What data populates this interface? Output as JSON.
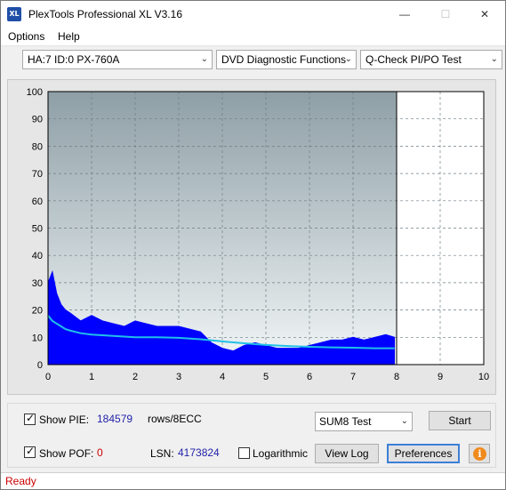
{
  "window": {
    "title": "PlexTools Professional XL V3.16",
    "icon_text": "XL",
    "minimize_glyph": "—",
    "maximize_glyph": "☐",
    "close_glyph": "✕"
  },
  "menu": {
    "options": "Options",
    "help": "Help"
  },
  "toolbar": {
    "drive": "HA:7 ID:0  PX-760A",
    "function": "DVD Diagnostic Functions",
    "test": "Q-Check PI/PO Test",
    "arrow_glyph": "⌄"
  },
  "chart_data": {
    "type": "area",
    "x_ticks": [
      "0",
      "1",
      "2",
      "3",
      "4",
      "5",
      "6",
      "7",
      "8",
      "9",
      "10"
    ],
    "y_ticks": [
      "0",
      "10",
      "20",
      "30",
      "40",
      "50",
      "60",
      "70",
      "80",
      "90",
      "100"
    ],
    "xlim": [
      0,
      10
    ],
    "ylim": [
      0,
      100
    ],
    "grid": true,
    "end_marker_x": 8,
    "series": [
      {
        "color": "#0000ff",
        "x": [
          0.0,
          0.1,
          0.2,
          0.3,
          0.4,
          0.5,
          0.75,
          1.0,
          1.25,
          1.5,
          1.75,
          2.0,
          2.25,
          2.5,
          2.75,
          3.0,
          3.25,
          3.5,
          3.75,
          4.0,
          4.25,
          4.5,
          4.75,
          5.0,
          5.25,
          5.5,
          5.75,
          6.0,
          6.25,
          6.5,
          6.75,
          7.0,
          7.25,
          7.5,
          7.75,
          7.95
        ],
        "y": [
          30,
          34,
          26,
          22,
          20,
          19,
          16,
          18,
          16,
          15,
          14,
          16,
          15,
          14,
          14,
          14,
          13,
          12,
          8,
          6,
          5,
          7,
          8,
          7,
          6,
          6,
          6,
          7,
          8,
          9,
          9,
          10,
          9,
          10,
          11,
          10
        ]
      },
      {
        "color": "#20c0e8",
        "x": [
          0.0,
          0.1,
          0.2,
          0.3,
          0.4,
          0.5,
          0.75,
          1.0,
          1.5,
          2.0,
          2.5,
          3.0,
          3.5,
          4.0,
          4.5,
          5.0,
          5.5,
          6.0,
          6.5,
          7.0,
          7.5,
          7.95
        ],
        "y": [
          18,
          16,
          15,
          14,
          13,
          12.5,
          11.5,
          11,
          10.5,
          10,
          10,
          9.8,
          9.3,
          8.5,
          7.8,
          7.2,
          6.8,
          6.5,
          6.3,
          6.2,
          6.0,
          6.0
        ]
      }
    ]
  },
  "controls": {
    "show_pie_label": "Show PIE:",
    "show_pie_value": "184579",
    "rows_label": "rows/8ECC",
    "show_pof_label": "Show POF:",
    "show_pof_value": "0",
    "lsn_label": "LSN:",
    "lsn_value": "4173824",
    "logarithmic_label": "Logarithmic",
    "sum_select": "SUM8 Test",
    "start_button": "Start",
    "view_log_button": "View Log",
    "preferences_button": "Preferences",
    "check_glyph": "✓",
    "info_glyph": "i"
  },
  "status": {
    "text": "Ready"
  }
}
